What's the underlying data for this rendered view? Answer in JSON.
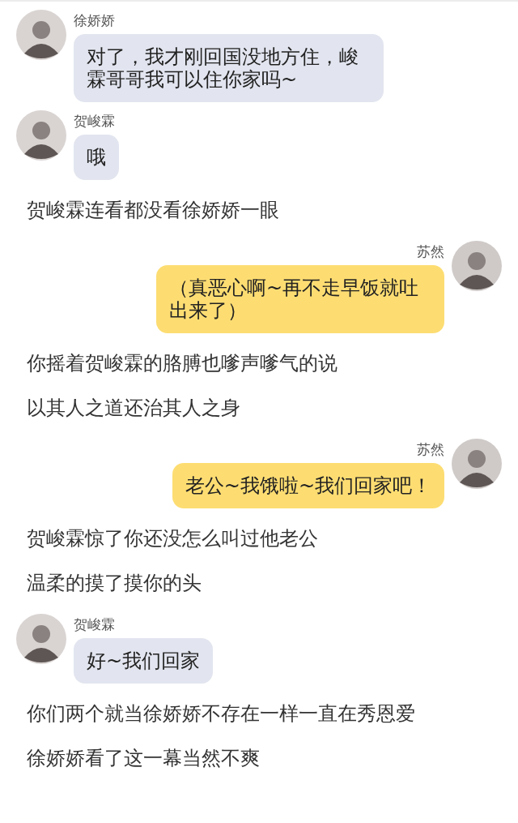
{
  "messages": [
    {
      "kind": "left",
      "sender": "徐娇娇",
      "text": "对了，我才刚回国没地方住，峻霖哥哥我可以住你家吗~"
    },
    {
      "kind": "left",
      "sender": "贺峻霖",
      "text": "哦"
    },
    {
      "kind": "narration",
      "text": "贺峻霖连看都没看徐娇娇一眼"
    },
    {
      "kind": "right",
      "sender": "苏然",
      "text": "（真恶心啊~再不走早饭就吐出来了）"
    },
    {
      "kind": "narration",
      "text": "你摇着贺峻霖的胳膊也嗲声嗲气的说"
    },
    {
      "kind": "narration",
      "text": "以其人之道还治其人之身"
    },
    {
      "kind": "right",
      "sender": "苏然",
      "text": "老公~我饿啦~我们回家吧！"
    },
    {
      "kind": "narration",
      "text": "贺峻霖惊了你还没怎么叫过他老公"
    },
    {
      "kind": "narration",
      "text": "温柔的摸了摸你的头"
    },
    {
      "kind": "left",
      "sender": "贺峻霖",
      "text": "好~我们回家"
    },
    {
      "kind": "narration",
      "text": "你们两个就当徐娇娇不存在一样一直在秀恩爱"
    },
    {
      "kind": "narration",
      "text": "徐娇娇看了这一幕当然不爽"
    }
  ]
}
